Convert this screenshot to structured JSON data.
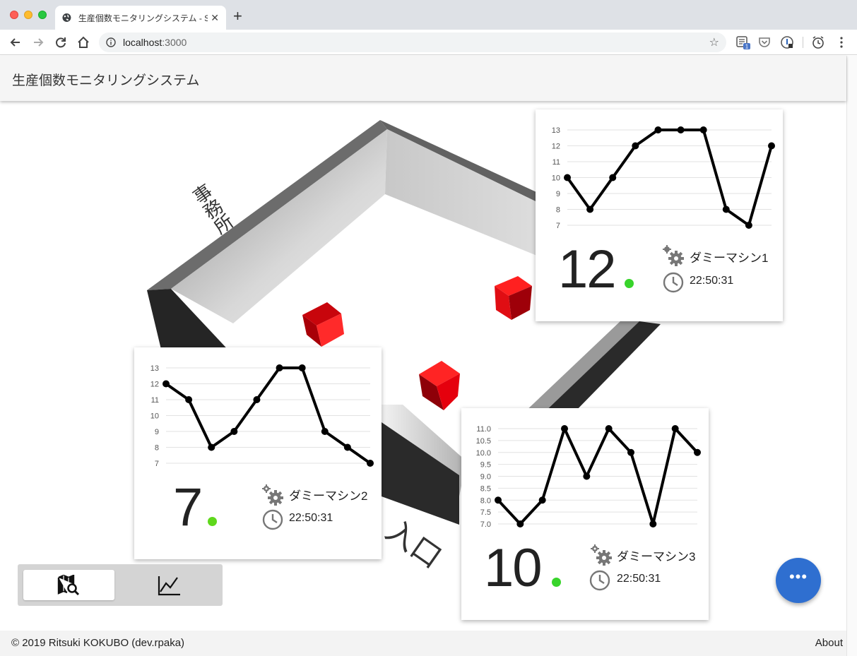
{
  "browser": {
    "tab_title": "生産個数モニタリングシステム - S",
    "url_host": "localhost",
    "url_port": ":3000",
    "extension_badge": "1"
  },
  "app": {
    "title": "生産個数モニタリングシステム",
    "floor_labels": {
      "office": "事務所",
      "entrance": "入口"
    }
  },
  "colors": {
    "accent": "#2f6fd0",
    "status_ok": "#38d42b",
    "cube": "#e0141a",
    "line": "#000000"
  },
  "icons": {
    "machine": "gears-icon",
    "time": "clock-icon",
    "map_view": "map-search-icon",
    "chart_view": "line-chart-icon",
    "fab": "more-horizontal-icon"
  },
  "machines": [
    {
      "count": "12",
      "name": "ダミーマシン1",
      "time": "22:50:31",
      "status": "ok"
    },
    {
      "count": "7",
      "name": "ダミーマシン2",
      "time": "22:50:31",
      "status": "ok"
    },
    {
      "count": "10",
      "name": "ダミーマシン3",
      "time": "22:50:31",
      "status": "ok"
    }
  ],
  "chart_data": [
    {
      "type": "line",
      "series": [
        {
          "values": [
            10,
            8,
            10,
            12,
            13,
            13,
            13,
            8,
            7,
            12
          ]
        }
      ],
      "yticks": [
        "7",
        "8",
        "9",
        "10",
        "11",
        "12",
        "13"
      ],
      "ylim": [
        7,
        13
      ],
      "grid": true
    },
    {
      "type": "line",
      "series": [
        {
          "values": [
            12,
            11,
            8,
            9,
            11,
            13,
            13,
            9,
            8,
            7
          ]
        }
      ],
      "yticks": [
        "7",
        "8",
        "9",
        "10",
        "11",
        "12",
        "13"
      ],
      "ylim": [
        7,
        13
      ],
      "grid": true
    },
    {
      "type": "line",
      "series": [
        {
          "values": [
            8,
            7,
            8,
            11,
            9,
            11,
            10,
            7,
            11,
            10
          ]
        }
      ],
      "yticks": [
        "7.0",
        "7.5",
        "8.0",
        "8.5",
        "9.0",
        "9.5",
        "10.0",
        "10.5",
        "11.0"
      ],
      "ylim": [
        7,
        11
      ],
      "grid": true
    }
  ],
  "footer": {
    "copyright": "© 2019 Ritsuki KOKUBO (dev.rpaka)",
    "about": "About"
  }
}
